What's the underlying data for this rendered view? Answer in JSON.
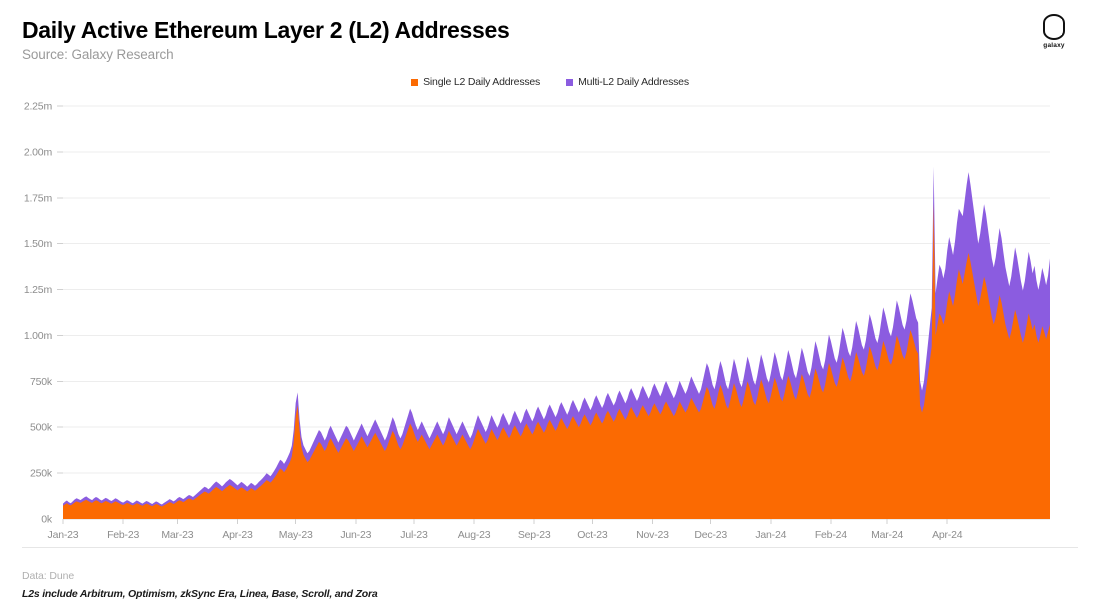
{
  "header": {
    "title": "Daily Active Ethereum Layer 2 (L2) Addresses",
    "subtitle": "Source: Galaxy Research"
  },
  "logo": {
    "name": "galaxy-logo",
    "wordmark": "galaxy"
  },
  "footer": {
    "data_source": "Data: Dune",
    "note": "L2s include Arbitrum, Optimism, zkSync Era, Linea, Base, Scroll, and Zora"
  },
  "colors": {
    "single_l2": "#FB6A02",
    "multi_l2": "#8B5CE0",
    "grid": "#ededed",
    "axis_text": "#8d8d8d",
    "title": "#000000",
    "subtitle": "#9a9a9a"
  },
  "chart_data": {
    "type": "area",
    "stacked": true,
    "title": "Daily Active Ethereum Layer 2 (L2) Addresses",
    "subtitle": "Source: Galaxy Research",
    "xlabel": "",
    "ylabel": "",
    "ylim": [
      0,
      2250000
    ],
    "grid": true,
    "legend_position": "top-center",
    "y_ticks": [
      0,
      250000,
      500000,
      750000,
      1000000,
      1250000,
      1500000,
      1750000,
      2000000,
      2250000
    ],
    "y_tick_labels": [
      "0k",
      "250k",
      "500k",
      "750k",
      "1.00m",
      "1.25m",
      "1.50m",
      "1.75m",
      "2.00m",
      "2.25m"
    ],
    "x_tick_labels": [
      "Jan-23",
      "Feb-23",
      "Mar-23",
      "Apr-23",
      "May-23",
      "Jun-23",
      "Jul-23",
      "Aug-23",
      "Sep-23",
      "Oct-23",
      "Nov-23",
      "Dec-23",
      "Jan-24",
      "Feb-24",
      "Mar-24",
      "Apr-24"
    ],
    "x_tick_positions": [
      0,
      31,
      59,
      90,
      120,
      151,
      181,
      212,
      243,
      273,
      304,
      334,
      365,
      396,
      425,
      456
    ],
    "n_points": 487,
    "series": [
      {
        "name": "Single L2 Daily Addresses",
        "color": "#FB6A02",
        "values": [
          72000,
          80000,
          86000,
          78000,
          74000,
          82000,
          90000,
          96000,
          92000,
          88000,
          94000,
          100000,
          104000,
          98000,
          92000,
          88000,
          96000,
          102000,
          98000,
          90000,
          86000,
          92000,
          98000,
          94000,
          88000,
          84000,
          90000,
          96000,
          92000,
          86000,
          80000,
          76000,
          82000,
          88000,
          84000,
          78000,
          74000,
          80000,
          86000,
          82000,
          76000,
          72000,
          78000,
          84000,
          80000,
          74000,
          70000,
          76000,
          82000,
          78000,
          72000,
          68000,
          74000,
          80000,
          86000,
          92000,
          88000,
          82000,
          88000,
          96000,
          102000,
          98000,
          92000,
          98000,
          106000,
          112000,
          108000,
          102000,
          110000,
          118000,
          126000,
          134000,
          142000,
          150000,
          146000,
          138000,
          146000,
          156000,
          166000,
          174000,
          168000,
          160000,
          152000,
          160000,
          170000,
          178000,
          186000,
          180000,
          172000,
          164000,
          156000,
          164000,
          172000,
          166000,
          158000,
          150000,
          158000,
          168000,
          162000,
          154000,
          162000,
          172000,
          180000,
          190000,
          200000,
          212000,
          206000,
          198000,
          210000,
          225000,
          240000,
          258000,
          275000,
          268000,
          255000,
          270000,
          290000,
          310000,
          340000,
          420000,
          560000,
          620000,
          480000,
          390000,
          350000,
          330000,
          310000,
          320000,
          340000,
          360000,
          380000,
          400000,
          420000,
          410000,
          390000,
          370000,
          390000,
          420000,
          440000,
          420000,
          400000,
          380000,
          360000,
          380000,
          400000,
          420000,
          440000,
          430000,
          410000,
          390000,
          370000,
          390000,
          410000,
          430000,
          450000,
          430000,
          410000,
          390000,
          410000,
          430000,
          450000,
          470000,
          450000,
          430000,
          410000,
          390000,
          370000,
          390000,
          420000,
          450000,
          480000,
          460000,
          430000,
          400000,
          380000,
          400000,
          430000,
          460000,
          490000,
          520000,
          500000,
          470000,
          440000,
          420000,
          440000,
          460000,
          440000,
          420000,
          400000,
          380000,
          400000,
          420000,
          440000,
          460000,
          440000,
          420000,
          400000,
          420000,
          450000,
          480000,
          460000,
          440000,
          420000,
          400000,
          420000,
          440000,
          460000,
          440000,
          420000,
          400000,
          380000,
          400000,
          430000,
          460000,
          490000,
          470000,
          450000,
          430000,
          410000,
          430000,
          460000,
          490000,
          470000,
          450000,
          430000,
          450000,
          480000,
          500000,
          480000,
          460000,
          440000,
          460000,
          490000,
          510000,
          490000,
          470000,
          450000,
          470000,
          500000,
          520000,
          500000,
          480000,
          460000,
          480000,
          510000,
          530000,
          510000,
          490000,
          470000,
          490000,
          520000,
          540000,
          520000,
          500000,
          480000,
          500000,
          530000,
          550000,
          530000,
          510000,
          490000,
          510000,
          540000,
          560000,
          540000,
          520000,
          500000,
          520000,
          550000,
          570000,
          550000,
          530000,
          510000,
          530000,
          560000,
          580000,
          560000,
          540000,
          520000,
          540000,
          570000,
          590000,
          570000,
          550000,
          530000,
          550000,
          580000,
          600000,
          580000,
          560000,
          540000,
          560000,
          590000,
          610000,
          590000,
          570000,
          550000,
          570000,
          600000,
          620000,
          600000,
          580000,
          560000,
          580000,
          610000,
          630000,
          610000,
          590000,
          570000,
          590000,
          620000,
          640000,
          620000,
          600000,
          580000,
          560000,
          580000,
          610000,
          640000,
          620000,
          600000,
          580000,
          600000,
          630000,
          660000,
          640000,
          620000,
          600000,
          580000,
          600000,
          640000,
          680000,
          720000,
          700000,
          660000,
          620000,
          600000,
          640000,
          690000,
          730000,
          700000,
          660000,
          620000,
          600000,
          640000,
          690000,
          740000,
          710000,
          670000,
          630000,
          610000,
          650000,
          700000,
          750000,
          720000,
          680000,
          640000,
          620000,
          660000,
          710000,
          760000,
          730000,
          690000,
          650000,
          630000,
          670000,
          720000,
          770000,
          740000,
          700000,
          660000,
          640000,
          680000,
          730000,
          780000,
          750000,
          710000,
          670000,
          650000,
          690000,
          740000,
          790000,
          760000,
          720000,
          680000,
          660000,
          700000,
          760000,
          820000,
          790000,
          750000,
          710000,
          690000,
          730000,
          790000,
          850000,
          820000,
          780000,
          740000,
          720000,
          760000,
          820000,
          880000,
          850000,
          810000,
          770000,
          750000,
          790000,
          850000,
          910000,
          880000,
          840000,
          800000,
          780000,
          820000,
          880000,
          940000,
          910000,
          870000,
          830000,
          810000,
          850000,
          910000,
          970000,
          940000,
          900000,
          860000,
          840000,
          880000,
          940000,
          1000000,
          970000,
          930000,
          890000,
          870000,
          910000,
          970000,
          1030000,
          1000000,
          960000,
          920000,
          900000,
          620000,
          580000,
          620000,
          700000,
          780000,
          860000,
          940000,
          1720000,
          1000000,
          1060000,
          1120000,
          1100000,
          1060000,
          1100000,
          1180000,
          1240000,
          1200000,
          1160000,
          1220000,
          1300000,
          1360000,
          1320000,
          1280000,
          1340000,
          1400000,
          1450000,
          1400000,
          1340000,
          1280000,
          1220000,
          1160000,
          1200000,
          1260000,
          1320000,
          1280000,
          1220000,
          1160000,
          1100000,
          1060000,
          1100000,
          1160000,
          1220000,
          1180000,
          1120000,
          1060000,
          1020000,
          980000,
          1020000,
          1080000,
          1140000,
          1100000,
          1050000,
          1000000,
          960000,
          1000000,
          1060000,
          1120000,
          1080000,
          1030000,
          1060000,
          1000000,
          960000,
          1000000,
          1050000,
          1020000,
          980000,
          1020000,
          1060000
        ]
      },
      {
        "name": "Multi-L2 Daily Addresses",
        "color": "#8B5CE0",
        "values": [
          12000,
          14000,
          15000,
          13000,
          12000,
          14000,
          16000,
          17000,
          16000,
          15000,
          16000,
          18000,
          19000,
          17000,
          16000,
          15000,
          17000,
          18000,
          17000,
          16000,
          15000,
          16000,
          17000,
          16000,
          15000,
          14000,
          15000,
          17000,
          16000,
          15000,
          14000,
          13000,
          14000,
          15000,
          14000,
          13000,
          12000,
          13000,
          15000,
          14000,
          13000,
          12000,
          13000,
          14000,
          14000,
          13000,
          12000,
          13000,
          14000,
          13000,
          12000,
          11000,
          13000,
          14000,
          15000,
          16000,
          15000,
          14000,
          15000,
          17000,
          18000,
          17000,
          16000,
          17000,
          18000,
          19000,
          19000,
          18000,
          19000,
          20000,
          22000,
          23000,
          25000,
          26000,
          25000,
          24000,
          25000,
          27000,
          29000,
          30000,
          29000,
          28000,
          26000,
          28000,
          30000,
          31000,
          32000,
          31000,
          30000,
          29000,
          27000,
          29000,
          30000,
          29000,
          28000,
          26000,
          28000,
          29000,
          28000,
          27000,
          28000,
          30000,
          32000,
          33000,
          35000,
          37000,
          36000,
          35000,
          37000,
          39000,
          42000,
          45000,
          48000,
          47000,
          45000,
          47000,
          50000,
          54000,
          59000,
          66000,
          72000,
          70000,
          62000,
          56000,
          52000,
          50000,
          48000,
          50000,
          53000,
          56000,
          59000,
          62000,
          65000,
          64000,
          61000,
          58000,
          61000,
          65000,
          68000,
          65000,
          62000,
          59000,
          56000,
          59000,
          62000,
          65000,
          68000,
          67000,
          64000,
          61000,
          58000,
          61000,
          64000,
          67000,
          70000,
          67000,
          64000,
          61000,
          64000,
          67000,
          70000,
          73000,
          70000,
          67000,
          64000,
          61000,
          58000,
          61000,
          65000,
          70000,
          75000,
          72000,
          67000,
          62000,
          59000,
          62000,
          67000,
          72000,
          76000,
          81000,
          78000,
          73000,
          69000,
          65000,
          69000,
          72000,
          69000,
          65000,
          62000,
          59000,
          62000,
          65000,
          69000,
          72000,
          69000,
          65000,
          62000,
          65000,
          70000,
          75000,
          72000,
          69000,
          65000,
          62000,
          65000,
          69000,
          72000,
          69000,
          65000,
          62000,
          59000,
          62000,
          67000,
          72000,
          76000,
          73000,
          70000,
          67000,
          64000,
          67000,
          72000,
          76000,
          73000,
          70000,
          67000,
          70000,
          75000,
          78000,
          75000,
          72000,
          69000,
          72000,
          76000,
          80000,
          76000,
          73000,
          70000,
          73000,
          78000,
          81000,
          78000,
          75000,
          72000,
          75000,
          80000,
          83000,
          80000,
          76000,
          73000,
          76000,
          81000,
          84000,
          81000,
          78000,
          75000,
          78000,
          84000,
          87000,
          84000,
          81000,
          78000,
          81000,
          86000,
          89000,
          86000,
          83000,
          80000,
          84000,
          89000,
          92000,
          89000,
          86000,
          83000,
          86000,
          91000,
          94000,
          91000,
          88000,
          85000,
          88000,
          94000,
          97000,
          94000,
          91000,
          88000,
          91000,
          96000,
          100000,
          97000,
          94000,
          90000,
          94000,
          99000,
          103000,
          100000,
          96000,
          93000,
          96000,
          102000,
          106000,
          102000,
          99000,
          95000,
          99000,
          105000,
          109000,
          105000,
          102000,
          98000,
          102000,
          108000,
          112000,
          108000,
          104000,
          101000,
          98000,
          102000,
          108000,
          113000,
          109000,
          105000,
          102000,
          106000,
          112000,
          117000,
          113000,
          109000,
          105000,
          102000,
          107000,
          114000,
          122000,
          129000,
          125000,
          118000,
          111000,
          107000,
          114000,
          123000,
          131000,
          126000,
          118000,
          111000,
          107000,
          115000,
          124000,
          133000,
          127000,
          120000,
          113000,
          109000,
          117000,
          126000,
          135000,
          129000,
          122000,
          115000,
          111000,
          119000,
          128000,
          137000,
          131000,
          124000,
          117000,
          113000,
          121000,
          130000,
          139000,
          133000,
          126000,
          119000,
          115000,
          123000,
          132000,
          141000,
          135000,
          128000,
          121000,
          117000,
          125000,
          134000,
          143000,
          137000,
          130000,
          123000,
          119000,
          127000,
          138000,
          149000,
          143000,
          136000,
          129000,
          125000,
          133000,
          144000,
          155000,
          149000,
          142000,
          135000,
          131000,
          139000,
          150000,
          162000,
          156000,
          148000,
          141000,
          137000,
          145000,
          157000,
          169000,
          163000,
          155000,
          147000,
          143000,
          151000,
          163000,
          176000,
          169000,
          161000,
          153000,
          149000,
          157000,
          170000,
          183000,
          176000,
          168000,
          160000,
          155000,
          164000,
          177000,
          191000,
          184000,
          175000,
          167000,
          162000,
          171000,
          185000,
          199000,
          191000,
          183000,
          174000,
          169000,
          130000,
          120000,
          130000,
          150000,
          170000,
          190000,
          210000,
          200000,
          230000,
          250000,
          265000,
          260000,
          250000,
          262000,
          282000,
          296000,
          288000,
          278000,
          292000,
          312000,
          330000,
          350000,
          370000,
          395000,
          420000,
          440000,
          420000,
          400000,
          380000,
          360000,
          340000,
          355000,
          375000,
          395000,
          380000,
          360000,
          340000,
          320000,
          310000,
          325000,
          345000,
          365000,
          350000,
          330000,
          312000,
          300000,
          288000,
          300000,
          320000,
          340000,
          328000,
          312000,
          296000,
          284000,
          296000,
          316000,
          336000,
          324000,
          308000,
          320000,
          300000,
          288000,
          300000,
          318000,
          306000,
          294000,
          306000,
          360000
        ]
      }
    ]
  }
}
